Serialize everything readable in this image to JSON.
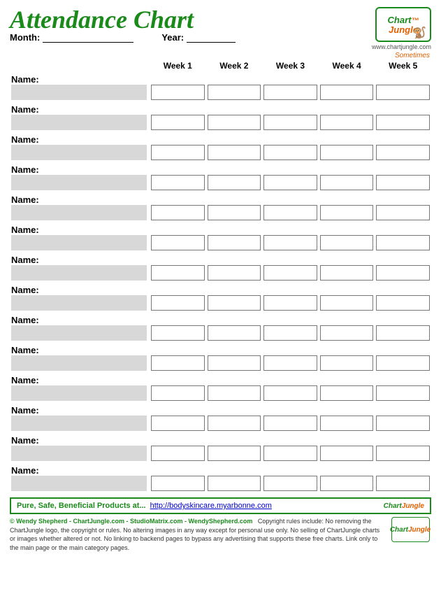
{
  "header": {
    "title": "Attendance Chart",
    "month_label": "Month:",
    "year_label": "Year:",
    "website": "www.chartjungle.com",
    "logo_chart": "Chart",
    "logo_jungle": "Jungle",
    "sometimes": "Sometimes"
  },
  "columns": {
    "week1": "Week 1",
    "week2": "Week 2",
    "week3": "Week 3",
    "week4": "Week 4",
    "week5": "Week 5"
  },
  "rows": [
    {
      "label": "Name:"
    },
    {
      "label": "Name:"
    },
    {
      "label": "Name:"
    },
    {
      "label": "Name:"
    },
    {
      "label": "Name:"
    },
    {
      "label": "Name:"
    },
    {
      "label": "Name:"
    },
    {
      "label": "Name:"
    },
    {
      "label": "Name:"
    },
    {
      "label": "Name:"
    },
    {
      "label": "Name:"
    },
    {
      "label": "Name:"
    },
    {
      "label": "Name:"
    },
    {
      "label": "Name:"
    }
  ],
  "banner": {
    "text": "Pure, Safe, Beneficial Products at...",
    "link": "http://bodyskincare.myarbonne.com"
  },
  "footer": {
    "copyright": "© Wendy Shepherd - ChartJungle.com - StudioMatrix.com - WendyShepherd.com",
    "rights": "Copyright rules include: No removing the ChartJungle logo, the copyright or rules. No altering images in any way except for personal use only. No selling of ChartJungle charts or images whether altered or not. No linking to backend pages to bypass any advertising that supports these free charts. Link only to the main page or the main category pages."
  }
}
